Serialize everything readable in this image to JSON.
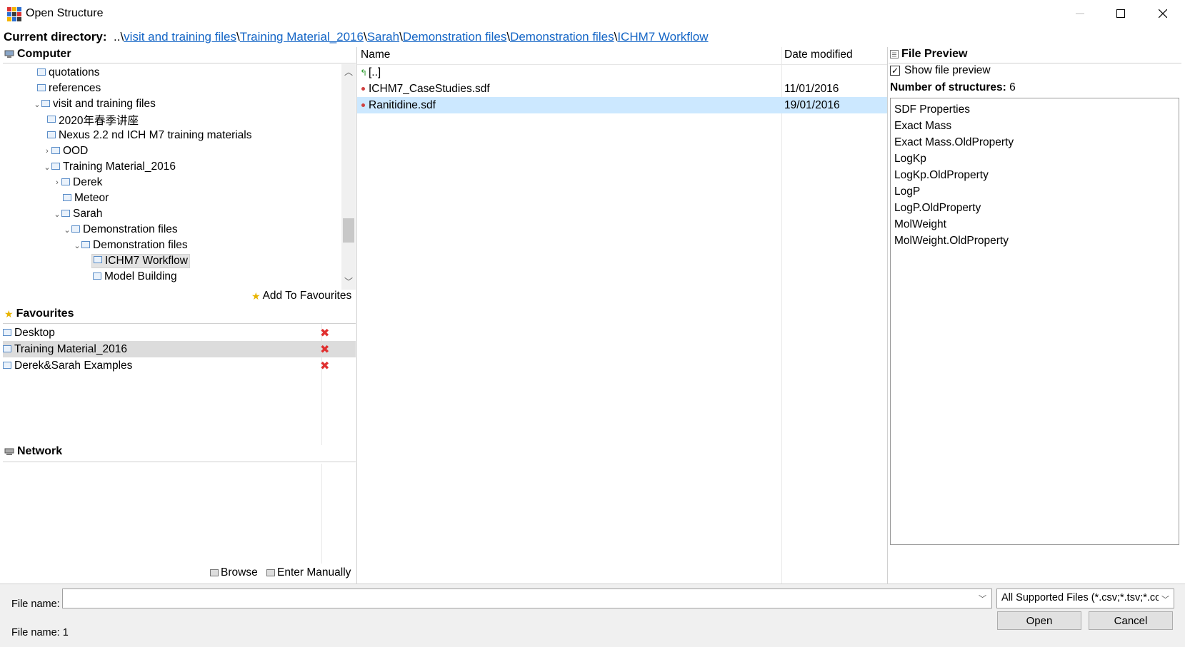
{
  "window": {
    "title": "Open Structure"
  },
  "current_directory": {
    "label": "Current directory:",
    "prefix": "..\\",
    "crumbs": [
      "visit and training files",
      "Training Material_2016",
      "Sarah",
      "Demonstration files",
      "Demonstration files",
      "ICHM7 Workflow"
    ],
    "sep": "\\"
  },
  "computer": {
    "title": "Computer",
    "tree": [
      {
        "label": "quotations"
      },
      {
        "label": "references"
      },
      {
        "label": "visit and training files"
      },
      {
        "label": "2020年春季讲座"
      },
      {
        "label": "Nexus 2.2 nd ICH M7 training materials"
      },
      {
        "label": "OOD"
      },
      {
        "label": "Training Material_2016"
      },
      {
        "label": "Derek"
      },
      {
        "label": "Meteor"
      },
      {
        "label": "Sarah"
      },
      {
        "label": "Demonstration files"
      },
      {
        "label": "Demonstration files"
      },
      {
        "label": "ICHM7 Workflow"
      },
      {
        "label": "Model Building"
      }
    ],
    "add_to_favourites": "Add To Favourites"
  },
  "favourites": {
    "title": "Favourites",
    "items": [
      {
        "label": "Desktop"
      },
      {
        "label": "Training Material_2016"
      },
      {
        "label": "Derek&Sarah Examples"
      }
    ],
    "remove_glyph": "✖"
  },
  "network": {
    "title": "Network",
    "browse": "Browse",
    "enter_manually": "Enter Manually"
  },
  "files": {
    "col_name": "Name",
    "col_date": "Date modified",
    "up": "[..]",
    "rows": [
      {
        "name": "ICHM7_CaseStudies.sdf",
        "date": "11/01/2016"
      },
      {
        "name": "Ranitidine.sdf",
        "date": "19/01/2016"
      }
    ]
  },
  "preview": {
    "title": "File Preview",
    "show_label": "Show file preview",
    "show_checked": true,
    "num_label": "Number of structures:",
    "num_value": "6",
    "properties": [
      "SDF Properties",
      "Exact Mass",
      "Exact Mass.OldProperty",
      "LogKp",
      "LogKp.OldProperty",
      "LogP",
      "LogP.OldProperty",
      "MolWeight",
      "MolWeight.OldProperty"
    ]
  },
  "footer": {
    "file_name_label": "File name:",
    "file_name_value": "",
    "filter": "All Supported Files (*.csv;*.tsv;*.co",
    "status": "File name: 1",
    "open": "Open",
    "cancel": "Cancel"
  }
}
